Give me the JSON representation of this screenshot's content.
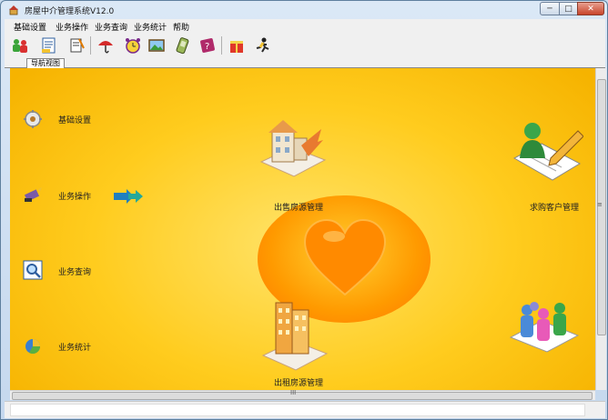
{
  "window": {
    "title": "房屋中介管理系统V12.0",
    "controls": {
      "minimize": "─",
      "maximize": "□",
      "close": "✕"
    }
  },
  "menu": [
    "基础设置",
    "业务操作",
    "业务查询",
    "业务统计",
    "帮助"
  ],
  "toolbar": {
    "icons": [
      "people-icon",
      "document-icon",
      "notes-icon",
      "umbrella-icon",
      "alarm-clock-icon",
      "picture-icon",
      "pda-icon",
      "help-book-icon",
      "gift-icon",
      "run-icon"
    ]
  },
  "tabs": {
    "nav_view": "导航视图"
  },
  "sidebar": {
    "items": [
      {
        "label": "基础设置",
        "icon": "gear-icon"
      },
      {
        "label": "业务操作",
        "icon": "pen-icon"
      },
      {
        "label": "业务查询",
        "icon": "magnifier-icon"
      },
      {
        "label": "业务统计",
        "icon": "pie-chart-icon"
      }
    ]
  },
  "center": {
    "sale": "出售房源管理",
    "buy": "求购客户管理",
    "rent": "出租房源管理",
    "tenant": ""
  },
  "scrollbars": {
    "v_grip": "≡",
    "h_grip": "III"
  },
  "colors": {
    "background": "#ffcc1e",
    "heart": "#ff8a00",
    "accent_blue": "#1e6fbf"
  }
}
